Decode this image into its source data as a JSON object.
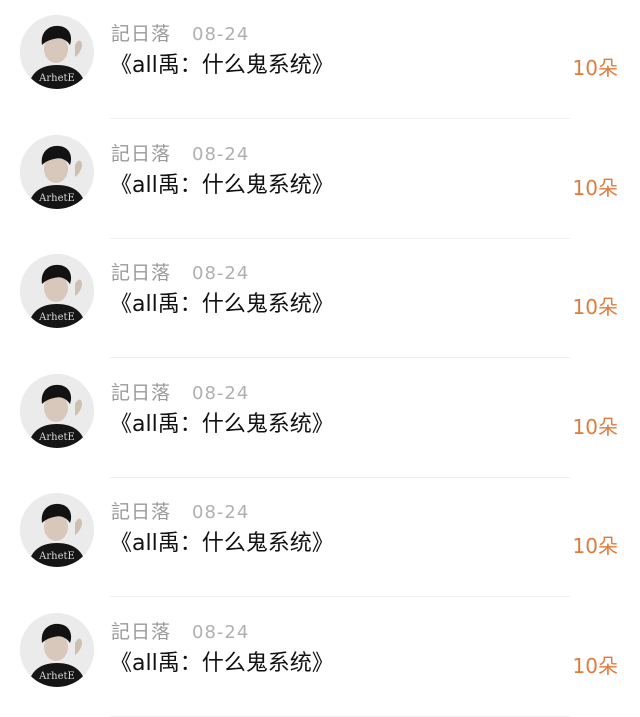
{
  "colors": {
    "accent": "#e07b3c",
    "meta_text": "#9a9a9a",
    "primary_text": "#111111"
  },
  "items": [
    {
      "username": "記日落",
      "date": "08-24",
      "title": "《all禹：什么鬼系统》",
      "gift": "10朵"
    },
    {
      "username": "記日落",
      "date": "08-24",
      "title": "《all禹：什么鬼系统》",
      "gift": "10朵"
    },
    {
      "username": "記日落",
      "date": "08-24",
      "title": "《all禹：什么鬼系统》",
      "gift": "10朵"
    },
    {
      "username": "記日落",
      "date": "08-24",
      "title": "《all禹：什么鬼系统》",
      "gift": "10朵"
    },
    {
      "username": "記日落",
      "date": "08-24",
      "title": "《all禹：什么鬼系统》",
      "gift": "10朵"
    },
    {
      "username": "記日落",
      "date": "08-24",
      "title": "《all禹：什么鬼系统》",
      "gift": "10朵"
    }
  ]
}
